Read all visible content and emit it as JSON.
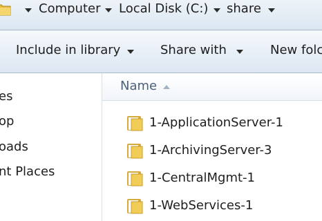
{
  "address": {
    "crumbs": [
      "Computer",
      "Local Disk (C:)",
      "share"
    ]
  },
  "toolbar": {
    "include_label": "Include in library",
    "share_label": "Share with",
    "newfolder_label": "New folc"
  },
  "nav": {
    "items": [
      "es",
      "op",
      "oads",
      "nt Places"
    ]
  },
  "filelist": {
    "column_name": "Name",
    "sort": "ascending",
    "folders": [
      "1-ApplicationServer-1",
      "1-ArchivingServer-3",
      "1-CentralMgmt-1",
      "1-WebServices-1"
    ]
  },
  "colors": {
    "folder": "#f1cd57",
    "header_text": "#4c607a"
  }
}
